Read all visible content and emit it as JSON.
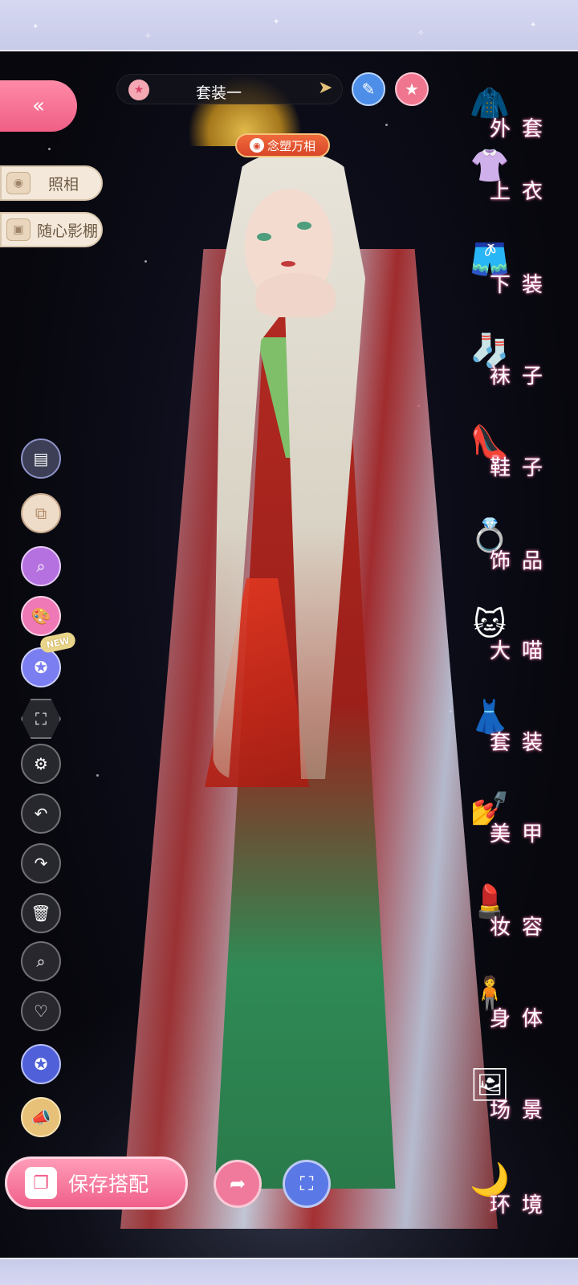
{
  "suit": {
    "name": "套装一"
  },
  "nianyu_tag": "念塑万相",
  "left_buttons": {
    "photo": "照相",
    "studio": "随心影棚"
  },
  "new_badge": "NEW",
  "categories": [
    {
      "label": "外套",
      "icon": "coat-icon",
      "emoji": "🧥"
    },
    {
      "label": "上衣",
      "icon": "shirt-icon",
      "emoji": "👚"
    },
    {
      "label": "下装",
      "icon": "shorts-icon",
      "emoji": "🩳"
    },
    {
      "label": "袜子",
      "icon": "sock-icon",
      "emoji": "🧦"
    },
    {
      "label": "鞋子",
      "icon": "shoe-icon",
      "emoji": "👠"
    },
    {
      "label": "饰品",
      "icon": "tiara-icon",
      "emoji": "💍"
    },
    {
      "label": "大喵",
      "icon": "cat-icon",
      "emoji": "🐱"
    },
    {
      "label": "套装",
      "icon": "outfit-icon",
      "emoji": "👗"
    },
    {
      "label": "美甲",
      "icon": "nail-polish-icon",
      "emoji": "💅"
    },
    {
      "label": "妆容",
      "icon": "makeup-icon",
      "emoji": "💄"
    },
    {
      "label": "身体",
      "icon": "body-icon",
      "emoji": "🧍"
    },
    {
      "label": "场景",
      "icon": "scene-icon",
      "emoji": "🖼"
    },
    {
      "label": "环境",
      "icon": "environment-icon",
      "emoji": "🌙"
    }
  ],
  "save_button": {
    "label": "保存搭配"
  },
  "colors": {
    "accent_pink": "#f0608a",
    "frame_lavender": "#d6d8f2",
    "label_glow": "#e46fa4"
  }
}
